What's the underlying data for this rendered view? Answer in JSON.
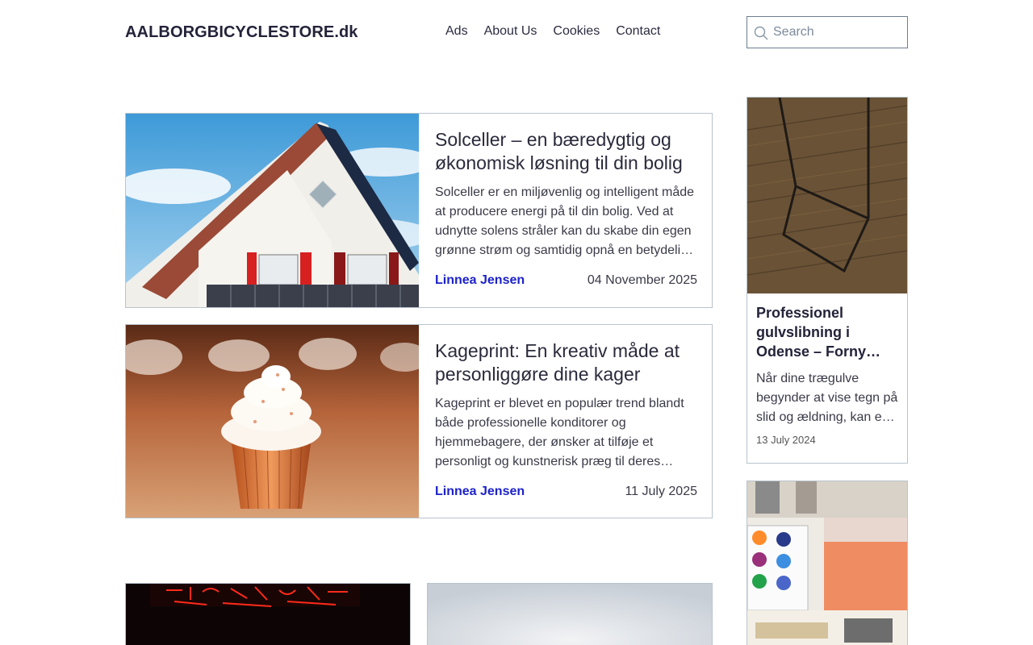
{
  "header": {
    "site_title": "AALBORGBICYCLESTORE.dk",
    "nav": [
      "Ads",
      "About Us",
      "Cookies",
      "Contact"
    ],
    "search_placeholder": "Search"
  },
  "articles": [
    {
      "title": "Solceller – en bæredygtig og økonomisk løsning til din bolig",
      "excerpt": "Solceller er en miljøvenlig og intelligent måde at producere energi på til din bolig. Ved at udnytte solens stråler kan du skabe din egen grønne strøm og samtidig opnå en betydelig besparelse på din elregning.",
      "author": "Linnea Jensen",
      "date": "04 November 2025",
      "image": "house-with-solar-panels"
    },
    {
      "title": "Kageprint: En kreativ måde at personliggøre dine kager",
      "excerpt": "Kageprint er blevet en populær trend blandt både professionelle konditorer og hjemmebagere, der ønsker at tilføje et personligt og kunstnerisk præg til deres kager.",
      "author": "Linnea Jensen",
      "date": "11 July 2025",
      "image": "cupcake"
    }
  ],
  "sidebar": [
    {
      "title": "Professionel gulvslibning i Odense – Forny dine gulve",
      "excerpt": "Når dine trægulve begynder at vise tegn på slid og ældning, kan en professionel gulvslibning gøre underværker.",
      "date": "13 July 2024",
      "image": "wooden-floor"
    },
    {
      "image": "paint-palette"
    }
  ],
  "bottom": [
    {
      "image": "neon-sign"
    },
    {
      "image": "light-gradient"
    }
  ],
  "colors": {
    "author_link": "#1c22c8",
    "border": "#b9c4cc",
    "title": "#23233a"
  }
}
